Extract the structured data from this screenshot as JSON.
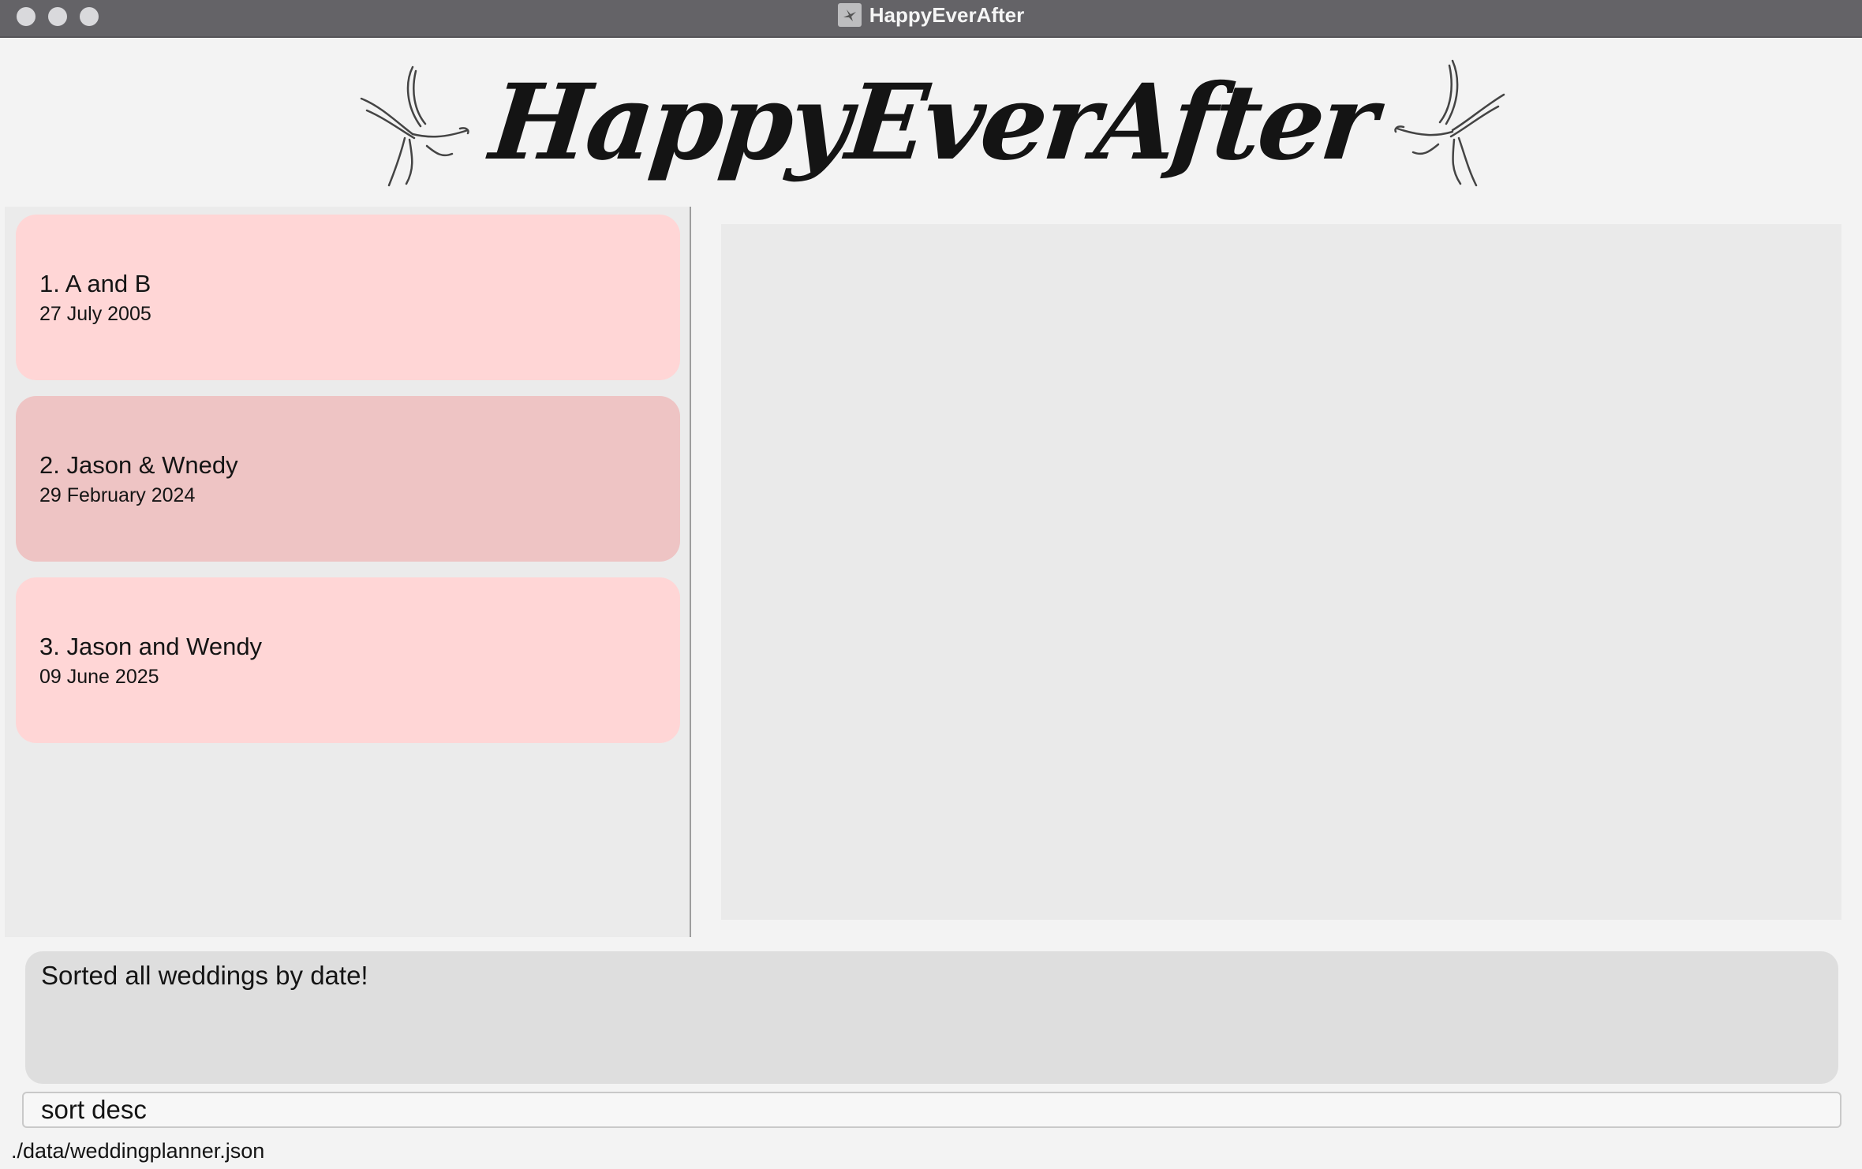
{
  "window": {
    "title": "HappyEverAfter"
  },
  "banner": {
    "logo_text": "HappyEverAfter"
  },
  "weddings": [
    {
      "name": "1. A and B",
      "date": "27 July 2005"
    },
    {
      "name": "2. Jason & Wnedy",
      "date": "29 February 2024"
    },
    {
      "name": "3. Jason and Wendy",
      "date": "09 June 2025"
    }
  ],
  "result": {
    "message": "Sorted all weddings by date!"
  },
  "command": {
    "value": "sort desc"
  },
  "status": {
    "file_path": "./data/weddingplanner.json"
  },
  "colors": {
    "card": "#ffd6d6",
    "card_selected": "#eec4c4",
    "titlebar": "#646367"
  },
  "icons": {
    "app": "dove-icon",
    "banner_left": "dove-icon",
    "banner_right": "dove-icon"
  }
}
